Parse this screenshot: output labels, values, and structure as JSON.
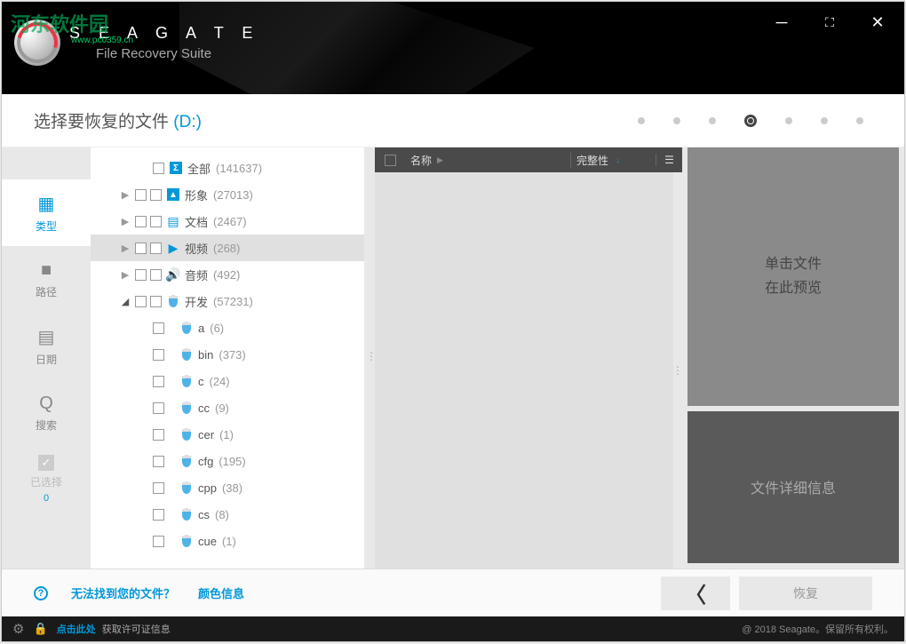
{
  "watermark": "河东软件园",
  "watermark_url": "www.pc0359.cn",
  "brand": {
    "name": "S E A G A T E",
    "subtitle": "File Recovery Suite"
  },
  "page_title": {
    "text": "选择要恢复的文件",
    "drive": "(D:)"
  },
  "sidebar": {
    "type": "类型",
    "path": "路径",
    "date": "日期",
    "search": "搜索",
    "selected": "已选择",
    "selected_count": "0"
  },
  "tree": {
    "all": {
      "label": "全部",
      "count": "(141637)"
    },
    "image": {
      "label": "形象",
      "count": "(27013)"
    },
    "doc": {
      "label": "文档",
      "count": "(2467)"
    },
    "video": {
      "label": "视频",
      "count": "(268)"
    },
    "audio": {
      "label": "音频",
      "count": "(492)"
    },
    "dev": {
      "label": "开发",
      "count": "(57231)"
    },
    "children": [
      {
        "label": "a",
        "count": "(6)"
      },
      {
        "label": "bin",
        "count": "(373)"
      },
      {
        "label": "c",
        "count": "(24)"
      },
      {
        "label": "cc",
        "count": "(9)"
      },
      {
        "label": "cer",
        "count": "(1)"
      },
      {
        "label": "cfg",
        "count": "(195)"
      },
      {
        "label": "cpp",
        "count": "(38)"
      },
      {
        "label": "cs",
        "count": "(8)"
      },
      {
        "label": "cue",
        "count": "(1)"
      }
    ]
  },
  "list_header": {
    "name": "名称",
    "integrity": "完整性"
  },
  "preview": {
    "line1": "单击文件",
    "line2": "在此预览",
    "details": "文件详细信息"
  },
  "footer": {
    "help_q": "无法找到您的文件？",
    "color_info": "颜色信息",
    "recover": "恢复"
  },
  "status": {
    "click_here": "点击此处",
    "license_msg": "获取许可证信息",
    "copyright": "@ 2018 Seagate。保留所有权利。"
  }
}
